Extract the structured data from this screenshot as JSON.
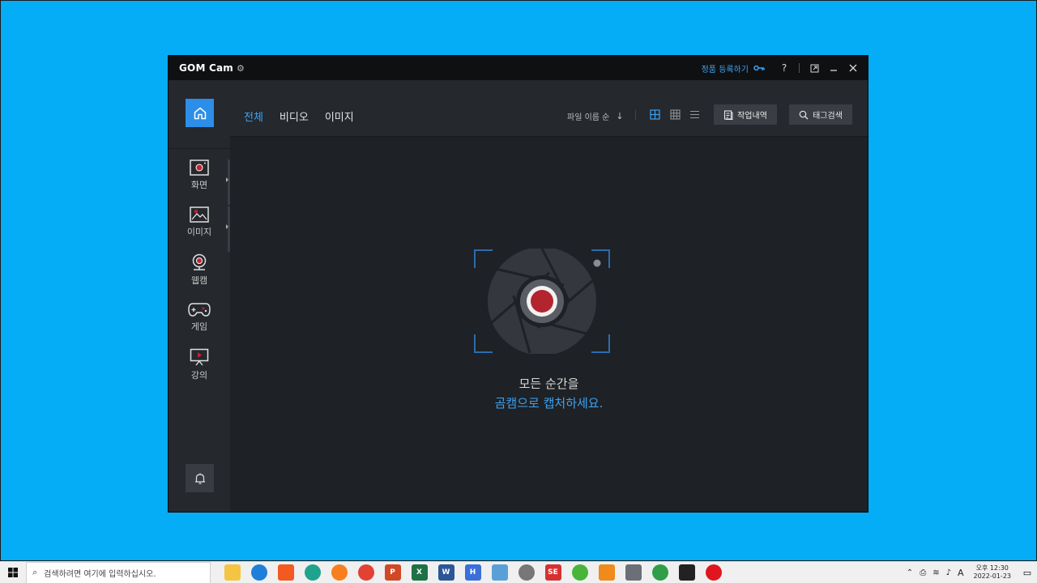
{
  "window": {
    "app_name": "GOM Cam",
    "register_label": "정품 등록하기",
    "help_label": "?"
  },
  "sidebar": {
    "items": [
      {
        "label": "화면"
      },
      {
        "label": "이미지"
      },
      {
        "label": "웹캠"
      },
      {
        "label": "게임"
      },
      {
        "label": "강의"
      }
    ]
  },
  "tabs": [
    {
      "label": "전체",
      "active": true
    },
    {
      "label": "비디오",
      "active": false
    },
    {
      "label": "이미지",
      "active": false
    }
  ],
  "sort": {
    "label": "파일 이름 순",
    "direction": "↓"
  },
  "toolbar": {
    "history_label": "작업내역",
    "tag_search_label": "태그검색"
  },
  "empty_state": {
    "line1": "모든 순간을",
    "line2": "곰캠으로 캡처하세요."
  },
  "taskbar": {
    "search_placeholder": "검색하려면 여기에 입력하십시오.",
    "time": "오후 12:30",
    "date": "2022-01-23",
    "ime": "A"
  },
  "colors": {
    "desktop": "#04adf5",
    "accent": "#3da3f4",
    "record_red": "#c8222c"
  }
}
